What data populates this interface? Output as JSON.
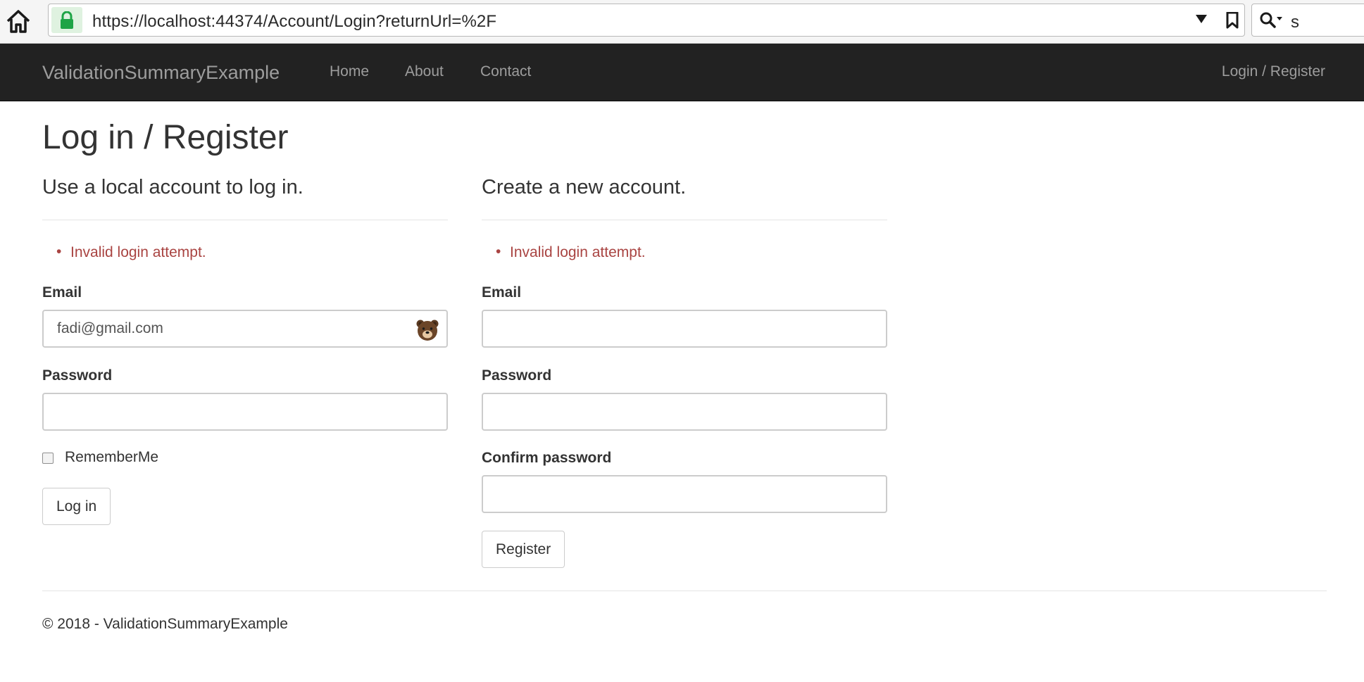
{
  "browser": {
    "url": "https://localhost:44374/Account/Login?returnUrl=%2F",
    "search_value": "s"
  },
  "navbar": {
    "brand": "ValidationSummaryExample",
    "links": [
      "Home",
      "About",
      "Contact"
    ],
    "login_register": "Login / Register"
  },
  "page": {
    "title": "Log in / Register"
  },
  "login": {
    "heading": "Use a local account to log in.",
    "validation_error": "Invalid login attempt.",
    "email_label": "Email",
    "email_value": "fadi@gmail.com",
    "password_label": "Password",
    "password_value": "",
    "remember_label": "RememberMe",
    "remember_checked": false,
    "submit_label": "Log in"
  },
  "register": {
    "heading": "Create a new account.",
    "validation_error": "Invalid login attempt.",
    "email_label": "Email",
    "email_value": "",
    "password_label": "Password",
    "password_value": "",
    "confirm_label": "Confirm password",
    "confirm_value": "",
    "submit_label": "Register"
  },
  "footer": {
    "text": "© 2018 - ValidationSummaryExample"
  },
  "colors": {
    "navbar_bg": "#222222",
    "navbar_text": "#9d9d9d",
    "error": "#a94442",
    "lock_green": "#1ea446"
  },
  "icons": [
    "home-icon",
    "lock-icon",
    "dropdown-arrow-icon",
    "bookmark-icon",
    "search-icon",
    "bear-icon"
  ]
}
